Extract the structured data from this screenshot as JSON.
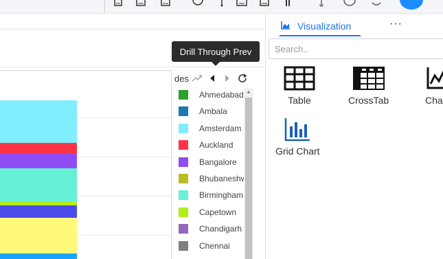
{
  "topbar": {
    "icons": [
      "doc-icon",
      "save-icon",
      "copy-icon",
      "history-icon",
      "pin-icon",
      "image-icon",
      "share-icon",
      "bulb-icon",
      "clock-icon",
      "bell-icon"
    ]
  },
  "legend": {
    "title": "des",
    "tooltip": "Drill Through Prev",
    "items": [
      {
        "label": "Ahmedabad",
        "color": "#2ca02c"
      },
      {
        "label": "Ambala",
        "color": "#1f77b4"
      },
      {
        "label": "Amsterdam",
        "color": "#7fefff"
      },
      {
        "label": "Auckland",
        "color": "#ff3344"
      },
      {
        "label": "Bangalore",
        "color": "#8f4cf5"
      },
      {
        "label": "Bhubaneshwar",
        "color": "#bcbd22"
      },
      {
        "label": "Birmingham",
        "color": "#66f0d8"
      },
      {
        "label": "Capetown",
        "color": "#b3ee1b"
      },
      {
        "label": "Chandigarh",
        "color": "#9467bd"
      },
      {
        "label": "Chennai",
        "color": "#7f7f7f"
      }
    ]
  },
  "chart": {
    "segments": [
      {
        "color": "#80eefe"
      },
      {
        "color": "#ff3344"
      },
      {
        "color": "#8f4cf5"
      },
      {
        "color": "#66f0d8"
      },
      {
        "color": "#b3ee1b"
      },
      {
        "color": "#4b4ce8"
      },
      {
        "color": "#fff97a"
      },
      {
        "color": "#1aa3ff"
      }
    ]
  },
  "right": {
    "tab_label": "Visualization",
    "more_label": "···",
    "search_placeholder": "Search..",
    "viz": [
      {
        "label": "Table",
        "icon": "table-icon"
      },
      {
        "label": "CrossTab",
        "icon": "crosstab-icon"
      },
      {
        "label": "Chart",
        "icon": "line-chart-icon"
      },
      {
        "label": "Grid Chart",
        "icon": "grid-chart-icon"
      }
    ]
  }
}
